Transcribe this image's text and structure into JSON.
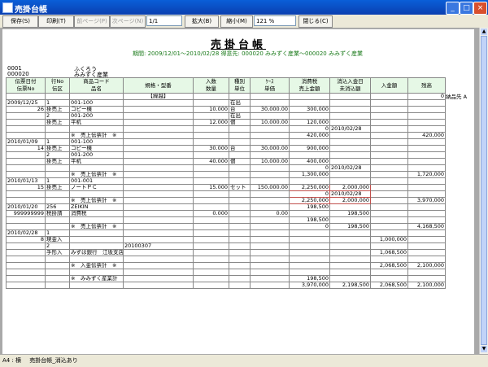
{
  "window": {
    "title": "売掛台帳"
  },
  "toolbar": {
    "save": "保存(S)",
    "print": "印刷(T)",
    "prev_page": "前ページ(P)",
    "next_page": "次ページ(N)",
    "page": "1/1",
    "zoom_in": "拡大(B)",
    "zoom_out": "縮小(M)",
    "zoom": "121 %",
    "close": "閉じる(C)"
  },
  "doc": {
    "title": "売掛台帳",
    "period": "期間: 2009/12/01～2010/02/28 得意先: 000020 みみずく産業～000020 みみずく産業",
    "cust_code1": "0001",
    "cust_code2": "000020",
    "cust_name1": "ふくろう",
    "cust_name2": "みみずく産業"
  },
  "headers": {
    "h1a": "伝票日付",
    "h1b": "伝票No",
    "h2a": "行No",
    "h2b": "伝区",
    "h3": "商品コード",
    "h3b": "品名",
    "h4": "規格・型番",
    "h5a": "入数",
    "h5b": "数量",
    "h6a": "種別",
    "h6b": "単位",
    "h7a": "ｹｰｽ",
    "h7b": "単価",
    "h8a": "消費税",
    "h8b": "売上金額",
    "h9a": "消込入金日",
    "h9b": "未消込額",
    "h10": "入金額",
    "h11": "残高"
  },
  "rows": [
    {
      "d": "",
      "n": "",
      "code": "",
      "spec": "【繰越】",
      "qty": "",
      "unit": "",
      "price": "",
      "amt": "",
      "unp": "",
      "dep": "",
      "bal": "0",
      "memo": ""
    },
    {
      "d": "2009/12/25",
      "n": "1",
      "code": "001-100",
      "spec": "",
      "qty": "",
      "unit": "在出",
      "price": "",
      "amt": "",
      "unp": "",
      "dep": "",
      "bal": "",
      "memo": "納品先 A"
    },
    {
      "d": "26",
      "n": "掛売上",
      "code": "コピー機",
      "spec": "",
      "qty": "10.000",
      "unit": "台",
      "price": "30,000.00",
      "amt": "300,000",
      "unp": "",
      "dep": "",
      "bal": "",
      "memo": ""
    },
    {
      "d": "",
      "n": "2",
      "code": "001-200",
      "spec": "",
      "qty": "",
      "unit": "在出",
      "price": "",
      "amt": "",
      "unp": "",
      "dep": "",
      "bal": "",
      "memo": ""
    },
    {
      "d": "",
      "n": "掛売上",
      "code": "平机",
      "spec": "",
      "qty": "12.000",
      "unit": "個",
      "price": "10,000.00",
      "amt": "120,000",
      "unp": "",
      "dep": "",
      "bal": "",
      "memo": ""
    },
    {
      "d": "",
      "n": "",
      "code": "",
      "spec": "",
      "qty": "",
      "unit": "",
      "price": "",
      "amt": "0",
      "unp": "2010/02/28",
      "dep": "",
      "bal": "",
      "memo": ""
    },
    {
      "d": "",
      "n": "",
      "code": "※　売上伝票計　※",
      "spec": "",
      "qty": "",
      "unit": "",
      "price": "",
      "amt": "420,000",
      "unp": "",
      "dep": "",
      "bal": "420,000",
      "memo": ""
    },
    {
      "d": "2010/01/09",
      "n": "1",
      "code": "001-100",
      "spec": "",
      "qty": "",
      "unit": "",
      "price": "",
      "amt": "",
      "unp": "",
      "dep": "",
      "bal": "",
      "memo": ""
    },
    {
      "d": "14",
      "n": "掛売上",
      "code": "コピー機",
      "spec": "",
      "qty": "30.000",
      "unit": "台",
      "price": "30,000.00",
      "amt": "900,000",
      "unp": "",
      "dep": "",
      "bal": "",
      "memo": ""
    },
    {
      "d": "",
      "n": "2",
      "code": "001-200",
      "spec": "",
      "qty": "",
      "unit": "",
      "price": "",
      "amt": "",
      "unp": "",
      "dep": "",
      "bal": "",
      "memo": ""
    },
    {
      "d": "",
      "n": "掛売上",
      "code": "平机",
      "spec": "",
      "qty": "40.000",
      "unit": "個",
      "price": "10,000.00",
      "amt": "400,000",
      "unp": "",
      "dep": "",
      "bal": "",
      "memo": ""
    },
    {
      "d": "",
      "n": "",
      "code": "",
      "spec": "",
      "qty": "",
      "unit": "",
      "price": "",
      "amt": "0",
      "unp": "2010/02/28",
      "dep": "",
      "bal": "",
      "memo": ""
    },
    {
      "d": "",
      "n": "",
      "code": "※　売上伝票計　※",
      "spec": "",
      "qty": "",
      "unit": "",
      "price": "",
      "amt": "1,300,000",
      "unp": "",
      "dep": "",
      "bal": "1,720,000",
      "memo": ""
    },
    {
      "d": "2010/01/13",
      "n": "1",
      "code": "001-001",
      "spec": "",
      "qty": "",
      "unit": "",
      "price": "",
      "amt": "",
      "unp": "",
      "dep": "",
      "bal": "",
      "memo": ""
    },
    {
      "d": "15",
      "n": "掛売上",
      "code": "ノートＰＣ",
      "spec": "",
      "qty": "15.000",
      "unit": "セット",
      "price": "150,000.00",
      "amt": "2,250,000",
      "unp": "2,000,000",
      "dep": "",
      "bal": "",
      "memo": ""
    },
    {
      "d": "",
      "n": "",
      "code": "",
      "spec": "",
      "qty": "",
      "unit": "",
      "price": "",
      "amt": "0",
      "unp": "2010/02/28",
      "dep": "",
      "bal": "",
      "memo": ""
    },
    {
      "d": "",
      "n": "",
      "code": "※　売上伝票計　※",
      "spec": "",
      "qty": "",
      "unit": "",
      "price": "",
      "amt": "2,250,000",
      "unp": "2,000,000",
      "dep": "",
      "bal": "3,970,000",
      "memo": ""
    },
    {
      "d": "2010/01/20",
      "n": "256",
      "code": "ZEIKIN",
      "spec": "",
      "qty": "",
      "unit": "",
      "price": "",
      "amt": "198,500",
      "unp": "",
      "dep": "",
      "bal": "",
      "memo": ""
    },
    {
      "d": "999999999",
      "n": "税掛請",
      "code": "消費税",
      "spec": "",
      "qty": "0.000",
      "unit": "",
      "price": "0.00",
      "amt": "",
      "unp": "198,500",
      "dep": "",
      "bal": "",
      "memo": ""
    },
    {
      "d": "",
      "n": "",
      "code": "",
      "spec": "",
      "qty": "",
      "unit": "",
      "price": "",
      "amt": "198,500",
      "unp": "",
      "dep": "",
      "bal": "",
      "memo": ""
    },
    {
      "d": "",
      "n": "",
      "code": "※　売上伝票計　※",
      "spec": "",
      "qty": "",
      "unit": "",
      "price": "",
      "amt": "0",
      "unp": "198,500",
      "dep": "",
      "bal": "4,168,500",
      "memo": ""
    },
    {
      "d": "2010/02/28",
      "n": "1",
      "code": "",
      "spec": "",
      "qty": "",
      "unit": "",
      "price": "",
      "amt": "",
      "unp": "",
      "dep": "",
      "bal": "",
      "memo": ""
    },
    {
      "d": "8",
      "n": "現金入",
      "code": "",
      "spec": "",
      "qty": "",
      "unit": "",
      "price": "",
      "amt": "",
      "unp": "",
      "dep": "1,000,000",
      "bal": "",
      "memo": ""
    },
    {
      "d": "",
      "n": "2",
      "code": "",
      "spec": "20100307",
      "qty": "",
      "unit": "",
      "price": "",
      "amt": "",
      "unp": "",
      "dep": "",
      "bal": "",
      "memo": ""
    },
    {
      "d": "",
      "n": "手形入",
      "code": "みずほ銀行　江坂支店　当座",
      "spec": "",
      "qty": "",
      "unit": "",
      "price": "",
      "amt": "",
      "unp": "",
      "dep": "1,068,500",
      "bal": "",
      "memo": ""
    },
    {
      "d": "",
      "n": "",
      "code": "",
      "spec": "",
      "qty": "",
      "unit": "",
      "price": "",
      "amt": "",
      "unp": "",
      "dep": "",
      "bal": "",
      "memo": ""
    },
    {
      "d": "",
      "n": "",
      "code": "※　入金伝票計　※",
      "spec": "",
      "qty": "",
      "unit": "",
      "price": "",
      "amt": "",
      "unp": "",
      "dep": "2,068,500",
      "bal": "2,100,000",
      "memo": ""
    },
    {
      "d": "",
      "n": "",
      "code": "",
      "spec": "",
      "qty": "",
      "unit": "",
      "price": "",
      "amt": "",
      "unp": "",
      "dep": "",
      "bal": "",
      "memo": ""
    },
    {
      "d": "",
      "n": "",
      "code": "※　みみずく産業計　※",
      "spec": "",
      "qty": "",
      "unit": "",
      "price": "",
      "amt": "198,500",
      "unp": "",
      "dep": "",
      "bal": "",
      "memo": ""
    },
    {
      "d": "",
      "n": "",
      "code": "",
      "spec": "",
      "qty": "",
      "unit": "",
      "price": "",
      "amt": "3,970,000",
      "unp": "2,198,500",
      "dep": "2,068,500",
      "bal": "2,100,000",
      "memo": ""
    }
  ],
  "status": {
    "paper": "A4 : 横",
    "doc": "売掛台帳_消込あり"
  }
}
